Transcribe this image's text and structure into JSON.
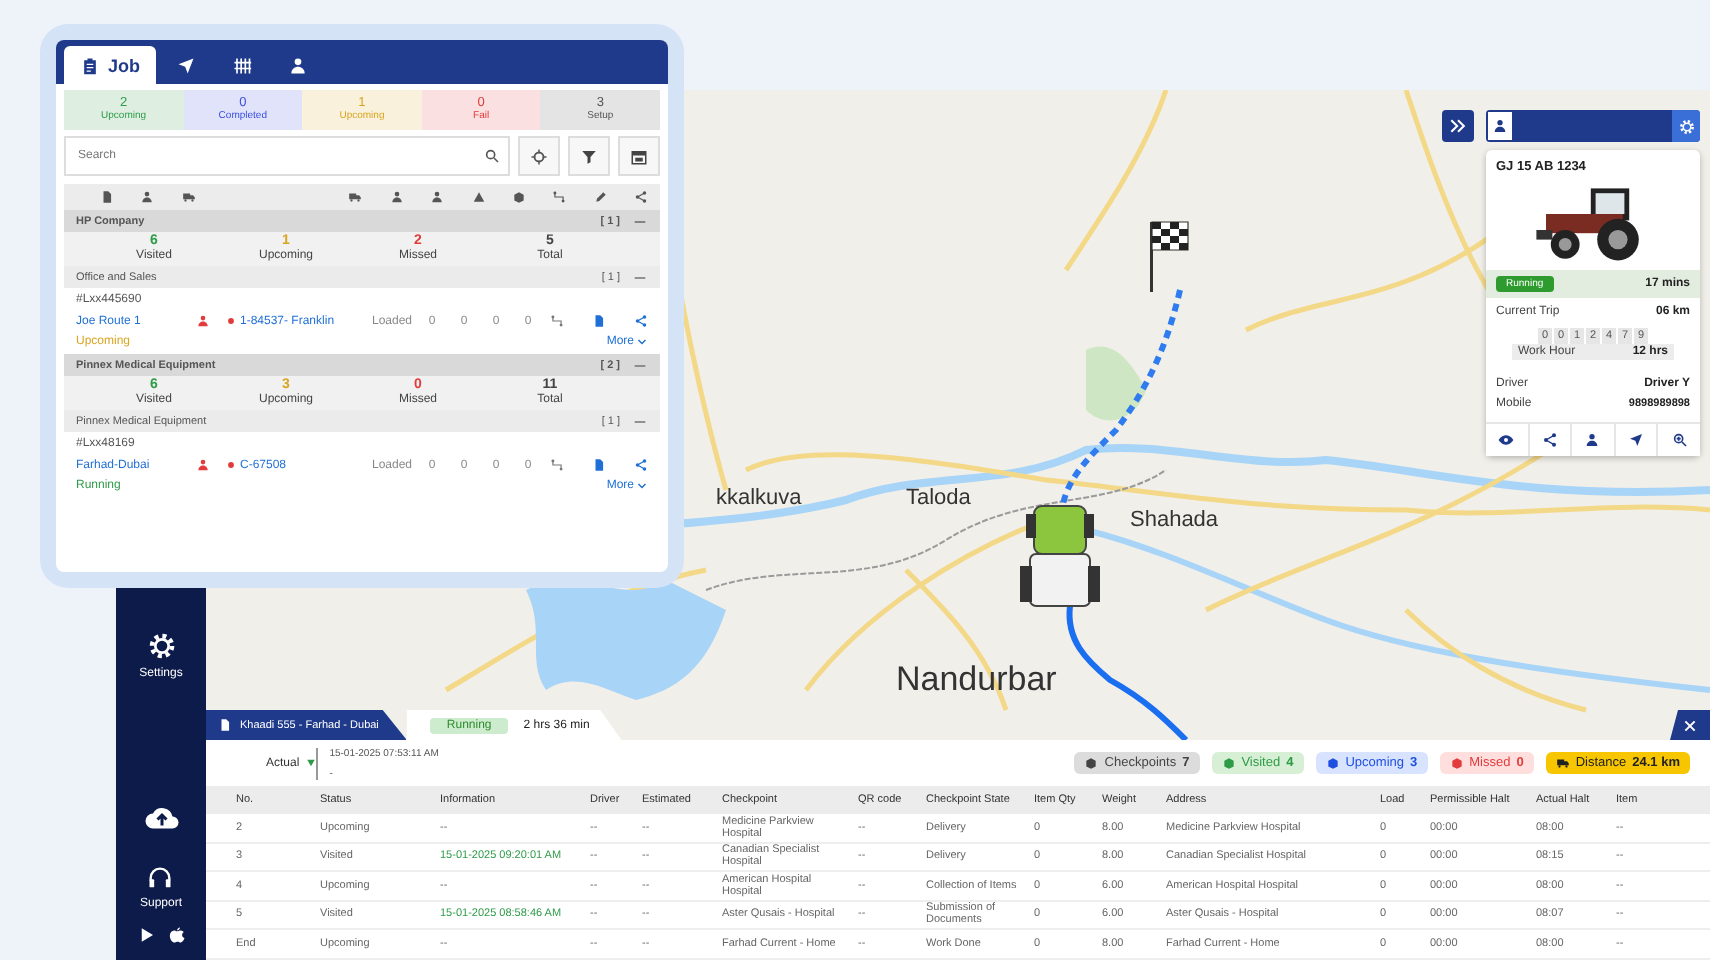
{
  "job_panel": {
    "tabs": [
      {
        "label": "Job",
        "selected": true
      },
      {
        "selected": false
      },
      {
        "selected": false
      },
      {
        "selected": false
      }
    ],
    "summary": [
      {
        "count": "2",
        "label": "Upcoming",
        "color": "#2e9b48"
      },
      {
        "count": "0",
        "label": "Completed",
        "color": "#3b4fe0"
      },
      {
        "count": "1",
        "label": "Upcoming",
        "color": "#d9a520"
      },
      {
        "count": "0",
        "label": "Fail",
        "color": "#e23b3b"
      },
      {
        "count": "3",
        "label": "Setup",
        "color": "#555555"
      }
    ],
    "search": {
      "placeholder": "Search"
    },
    "sections": [
      {
        "kind": "group",
        "name": "HP Company",
        "count": "[ 1 ]"
      },
      {
        "kind": "stats",
        "stats": [
          {
            "value": "6",
            "label": "Visited",
            "color": "#2e9b48"
          },
          {
            "value": "1",
            "label": "Upcoming",
            "color": "#d9a520"
          },
          {
            "value": "2",
            "label": "Missed",
            "color": "#e23b3b"
          },
          {
            "value": "5",
            "label": "Total",
            "color": "#444444"
          }
        ]
      },
      {
        "kind": "subgroup",
        "name": "Office and Sales",
        "count": "[ 1 ]"
      },
      {
        "kind": "job",
        "id": "#Lxx445690",
        "route": "Joe Route 1",
        "vehicle": "1-84537- Franklin",
        "load": "Loaded",
        "counts": [
          "0",
          "0",
          "0",
          "0"
        ],
        "status": "Upcoming",
        "color": "#d9a520",
        "more": "More"
      },
      {
        "kind": "group",
        "name": "Pinnex Medical Equipment",
        "count": "[ 2 ]"
      },
      {
        "kind": "stats",
        "stats": [
          {
            "value": "6",
            "label": "Visited",
            "color": "#2e9b48"
          },
          {
            "value": "3",
            "label": "Upcoming",
            "color": "#d9a520"
          },
          {
            "value": "0",
            "label": "Missed",
            "color": "#e23b3b"
          },
          {
            "value": "11",
            "label": "Total",
            "color": "#444444"
          }
        ]
      },
      {
        "kind": "subgroup",
        "name": "Pinnex Medical Equipment",
        "count": "[ 1 ]"
      },
      {
        "kind": "job",
        "id": "#Lxx48169",
        "route": "Farhad-Dubai",
        "vehicle": "C-67508",
        "load": "Loaded",
        "counts": [
          "0",
          "0",
          "0",
          "0"
        ],
        "status": "Running",
        "color": "#2e9b48",
        "more": "More"
      }
    ]
  },
  "map": {
    "labels": [
      {
        "text": "kkalkuva"
      },
      {
        "text": "Taloda"
      },
      {
        "text": "Shahada"
      },
      {
        "text": "Nandurbar"
      }
    ]
  },
  "sidebar": {
    "items": [
      {
        "kind": "settings",
        "label": "Settings"
      },
      {
        "kind": "upload"
      },
      {
        "kind": "support",
        "label": "Support"
      },
      {
        "kind": "stores"
      }
    ]
  },
  "vehicle": {
    "plate": "GJ 15 AB 1234",
    "status": "Running",
    "duration": "17 mins",
    "trip_label": "Current Trip",
    "trip": "06 km",
    "odometer": [
      "0",
      "0",
      "1",
      "2",
      "4",
      "7",
      "9"
    ],
    "hours_label": "Work Hour",
    "hours": "12 hrs",
    "driver_label": "Driver",
    "driver": "Driver Y",
    "mobile_label": "Mobile",
    "mobile": "9898989898"
  },
  "trip": {
    "title": "Khaadi 555 - Farhad - Dubai",
    "status": "Running",
    "elapsed": "2 hrs 36 min",
    "actual_label": "Actual",
    "actual_start": "15-01-2025 07:53:11 AM",
    "actual_end": "-",
    "chips": [
      {
        "kind": "checkpoints",
        "label": "Checkpoints",
        "value": "7"
      },
      {
        "kind": "visited",
        "label": "Visited",
        "value": "4"
      },
      {
        "kind": "upcoming",
        "label": "Upcoming",
        "value": "3"
      },
      {
        "kind": "missed",
        "label": "Missed",
        "value": "0"
      },
      {
        "kind": "distance",
        "label": "Distance",
        "value": "24.1 km"
      }
    ],
    "columns": [
      "No.",
      "Status",
      "Information",
      "Driver",
      "Estimated",
      "Checkpoint",
      "QR code",
      "Checkpoint State",
      "Item Qty",
      "Weight",
      "Address",
      "Load",
      "Permissible Halt",
      "Actual Halt",
      "Item"
    ],
    "rows": [
      {
        "cells": [
          "2",
          "Upcoming",
          "--",
          "--",
          "--",
          "Medicine Parkview Hospital",
          "--",
          "Delivery",
          "0",
          "8.00",
          "Medicine Parkview Hospital",
          "0",
          "00:00",
          "08:00",
          "--"
        ]
      },
      {
        "cells": [
          "3",
          "Visited",
          "15-01-2025 09:20:01 AM",
          "--",
          "--",
          "Canadian Specialist Hospital",
          "--",
          "Delivery",
          "0",
          "8.00",
          "Canadian Specialist Hospital",
          "0",
          "00:00",
          "08:15",
          "--"
        ],
        "color": "#2e9b48"
      },
      {
        "cells": [
          "4",
          "Upcoming",
          "--",
          "--",
          "--",
          "American Hospital Hospital",
          "--",
          "Collection of Items",
          "0",
          "6.00",
          "American Hospital Hospital",
          "0",
          "00:00",
          "08:00",
          "--"
        ]
      },
      {
        "cells": [
          "5",
          "Visited",
          "15-01-2025 08:58:46 AM",
          "--",
          "--",
          "Aster Qusais - Hospital",
          "--",
          "Submission of Documents",
          "0",
          "6.00",
          "Aster Qusais - Hospital",
          "0",
          "00:00",
          "08:07",
          "--"
        ],
        "color": "#2e9b48"
      },
      {
        "cells": [
          "End",
          "Upcoming",
          "--",
          "--",
          "--",
          "Farhad Current - Home",
          "--",
          "Work Done",
          "0",
          "8.00",
          "Farhad Current - Home",
          "0",
          "00:00",
          "08:00",
          "--"
        ]
      }
    ]
  }
}
